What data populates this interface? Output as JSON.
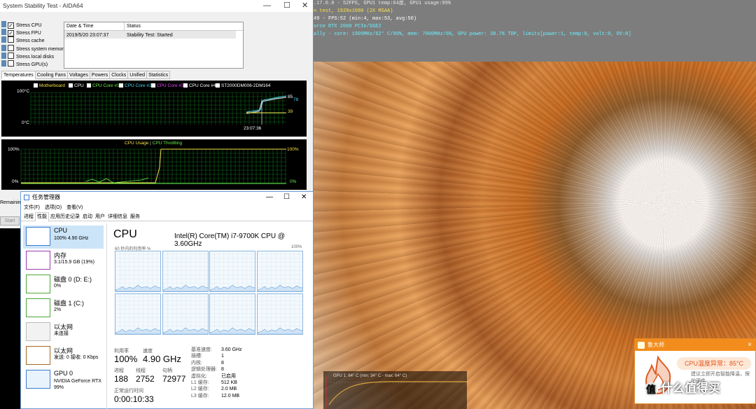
{
  "benchmark_osd": {
    "line1": ".17.0.0 - 52FPS, GPU1 temp:64度, GPU1 usage:99%",
    "line2": "n test, 1920x1080 (2X MSAA)",
    "line3": "49 - FPS:52 (min:4, max:53, avg:50)",
    "line4": "orce RTX 2060 PCIe/SSE2",
    "line5": "ally - core: 1905MHz/62° C/99%, mem: 7000MHz/6%, GPU power: 38.7% TDP, limits[power:1, temp:0, volt:0, OV:0]",
    "gpu_graph_label": "GPU 1: 64° C (min: 34° C - max: 64° C)"
  },
  "toast": {
    "app": "鲁大师",
    "close": "×",
    "alert": "CPU温度异常：85°C",
    "tip": "建议立即开启智能降温，保护硬件",
    "brand": "什么值得买",
    "brand_badge": "值"
  },
  "aida": {
    "title": "System Stability Test - AIDA64",
    "window_controls": [
      "—",
      "☐",
      "✕"
    ],
    "stress_options": [
      {
        "label": "Stress CPU",
        "checked": true
      },
      {
        "label": "Stress FPU",
        "checked": true
      },
      {
        "label": "Stress cache",
        "checked": false
      },
      {
        "label": "Stress system memory",
        "checked": false
      },
      {
        "label": "Stress local disks",
        "checked": false
      },
      {
        "label": "Stress GPU(s)",
        "checked": false
      }
    ],
    "log_headers": [
      "Date & Time",
      "Status"
    ],
    "log_rows": [
      [
        "2019/5/20 23:07:37",
        "Stability Test: Started"
      ]
    ],
    "tabs": [
      "Temperatures",
      "Cooling Fans",
      "Voltages",
      "Powers",
      "Clocks",
      "Unified",
      "Statistics"
    ],
    "temp_legend": [
      {
        "label": "Motherboard",
        "color": "#f4e04a"
      },
      {
        "label": "CPU",
        "color": "#ffffff"
      },
      {
        "label": "CPU Core #1",
        "color": "#6cf04a"
      },
      {
        "label": "CPU Core #2",
        "color": "#4ad8f0"
      },
      {
        "label": "CPU Core #3",
        "color": "#e04af0"
      },
      {
        "label": "CPU Core #4",
        "color": "#ffffff"
      },
      {
        "label": "ST2000DM006-2DM164",
        "color": "#ffffff"
      }
    ],
    "temp_ymax": "100°C",
    "temp_ymin": "0°C",
    "temp_time": "23:07:36",
    "temp_right_labels": [
      "85",
      "78",
      "39"
    ],
    "usage_title_a": "CPU Usage",
    "usage_sep": "|",
    "usage_title_b": "CPU Throttling",
    "usage_ymax": "100%",
    "usage_ymin": "0%",
    "usage_right": "100%",
    "usage_right_min": "0%",
    "remaining_label": "Remainin",
    "start_button": "Start"
  },
  "taskmgr": {
    "title": "任务管理器",
    "window_controls": [
      "—",
      "☐",
      "✕"
    ],
    "menu": [
      "文件(F)",
      "选项(O)",
      "查看(V)"
    ],
    "tabs": [
      "进程",
      "性能",
      "应用历史记录",
      "启动",
      "用户",
      "详细信息",
      "服务"
    ],
    "active_tab": 1,
    "sidebar": [
      {
        "name": "CPU",
        "sub": "100% 4.90 GHz",
        "sub2": "",
        "color": "#3a7bd5"
      },
      {
        "name": "内存",
        "sub": "3.1/15.9 GB (19%)",
        "sub2": "",
        "color": "#a03ab0"
      },
      {
        "name": "磁盘 0 (D: E:)",
        "sub": "0%",
        "sub2": "",
        "color": "#4aa534"
      },
      {
        "name": "磁盘 1 (C:)",
        "sub": "2%",
        "sub2": "",
        "color": "#4aa534"
      },
      {
        "name": "以太网",
        "sub": "未连接",
        "sub2": "",
        "color": "#bbbbbb"
      },
      {
        "name": "以太网",
        "sub": "发送: 0 接收: 0 Kbps",
        "sub2": "",
        "color": "#a86a1e"
      },
      {
        "name": "GPU 0",
        "sub": "NVIDIA GeForce RTX",
        "sub2": "99%",
        "color": "#3a7bd5"
      }
    ],
    "cpu_heading": "CPU",
    "cpu_model": "Intel(R) Core(TM) i7-9700K CPU @ 3.60GHz",
    "graph_caption": "60 秒内的利用率 %",
    "graph_max": "100%",
    "stats": {
      "util_label": "利用率",
      "util_value": "100%",
      "speed_label": "速度",
      "speed_value": "4.90 GHz",
      "proc_label": "进程",
      "proc_value": "188",
      "thread_label": "线程",
      "thread_value": "2752",
      "handle_label": "句柄",
      "handle_value": "72977",
      "uptime_label": "正常运行时间",
      "uptime_value": "0:00:10:33"
    },
    "details": [
      [
        "基准速度:",
        "3.60 GHz"
      ],
      [
        "插槽:",
        "1"
      ],
      [
        "内核:",
        "8"
      ],
      [
        "逻辑处理器:",
        "8"
      ],
      [
        "虚拟化:",
        "已启用"
      ],
      [
        "L1 缓存:",
        "512 KB"
      ],
      [
        "L2 缓存:",
        "2.0 MB"
      ],
      [
        "L3 缓存:",
        "12.0 MB"
      ]
    ]
  }
}
